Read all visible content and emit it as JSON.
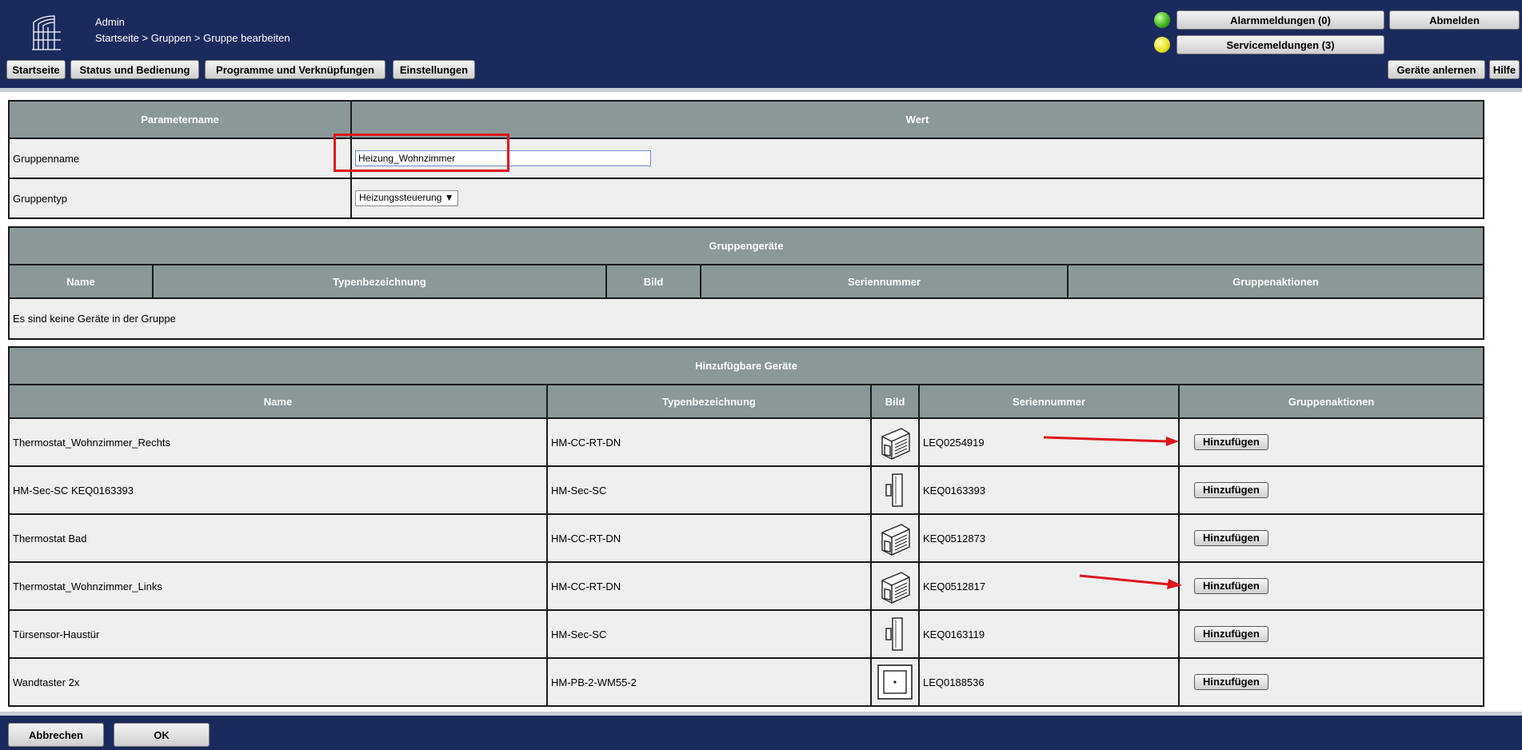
{
  "header": {
    "user": "Admin",
    "breadcrumb": "Startseite > Gruppen > Gruppe bearbeiten",
    "alarm_label": "Alarmmeldungen (0)",
    "service_label": "Servicemeldungen (3)",
    "logout_label": "Abmelden",
    "status_led_1_color": "#39b11d",
    "status_led_2_color": "#e8e11a",
    "nav": [
      "Startseite",
      "Status und Bedienung",
      "Programme und Verknüpfungen",
      "Einstellungen"
    ],
    "teach_label": "Geräte anlernen",
    "help_label": "Hilfe"
  },
  "params": {
    "col_name": "Parametername",
    "col_value": "Wert",
    "group_name_label": "Gruppenname",
    "group_name_value": "Heizung_Wohnzimmer",
    "group_type_label": "Gruppentyp",
    "group_type_value": "Heizungssteuerung"
  },
  "group_devices": {
    "title": "Gruppengeräte",
    "columns": [
      "Name",
      "Typenbezeichnung",
      "Bild",
      "Seriennummer",
      "Gruppenaktionen"
    ],
    "empty_text": "Es sind keine Geräte in der Gruppe"
  },
  "available": {
    "title": "Hinzufügbare Geräte",
    "columns": [
      "Name",
      "Typenbezeichnung",
      "Bild",
      "Seriennummer",
      "Gruppenaktionen"
    ],
    "action_label": "Hinzufügen",
    "rows": [
      {
        "name": "Thermostat_Wohnzimmer_Rechts",
        "type": "HM-CC-RT-DN",
        "icon": "thermostat-icon",
        "serial": "LEQ0254919"
      },
      {
        "name": "HM-Sec-SC KEQ0163393",
        "type": "HM-Sec-SC",
        "icon": "door-sensor-icon",
        "serial": "KEQ0163393"
      },
      {
        "name": "Thermostat Bad",
        "type": "HM-CC-RT-DN",
        "icon": "thermostat-icon",
        "serial": "KEQ0512873"
      },
      {
        "name": "Thermostat_Wohnzimmer_Links",
        "type": "HM-CC-RT-DN",
        "icon": "thermostat-icon",
        "serial": "KEQ0512817"
      },
      {
        "name": "Türsensor-Haustür",
        "type": "HM-Sec-SC",
        "icon": "door-sensor-icon",
        "serial": "KEQ0163119"
      },
      {
        "name": "Wandtaster 2x",
        "type": "HM-PB-2-WM55-2",
        "icon": "wall-switch-icon",
        "serial": "LEQ0188536"
      }
    ]
  },
  "footer": {
    "cancel_label": "Abbrechen",
    "ok_label": "OK"
  },
  "annotations": {
    "highlight_color": "#e0141b"
  }
}
